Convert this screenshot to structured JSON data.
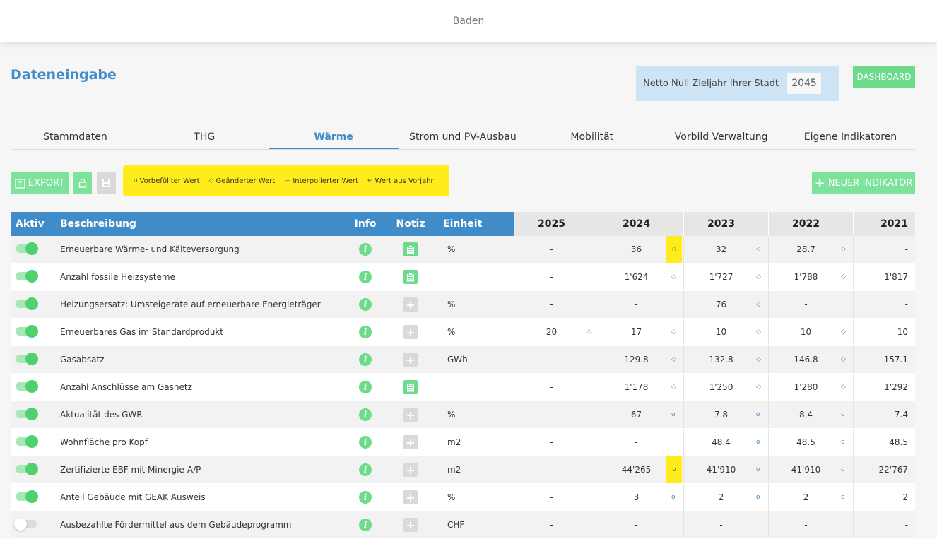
{
  "header": {
    "city": "Baden"
  },
  "page": {
    "title": "Dateneingabe"
  },
  "netto": {
    "label": "Netto Null Zieljahr Ihrer Stadt",
    "year": "2045"
  },
  "dashboard_label": "DASHBOARD",
  "tabs": [
    "Stammdaten",
    "THG",
    "Wärme",
    "Strom und PV-Ausbau",
    "Mobilität",
    "Vorbild Verwaltung",
    "Eigene Indikatoren"
  ],
  "active_tab": "Wärme",
  "toolbar": {
    "export_label": "EXPORT",
    "new_indicator_label": "NEUER INDIKATOR"
  },
  "legend": [
    {
      "symbol": "o",
      "label": "Vorbefüllter Wert"
    },
    {
      "symbol": "◇",
      "label": "Geänderter Wert"
    },
    {
      "symbol": "—",
      "label": "Interpolierter Wert"
    },
    {
      "symbol": "←",
      "label": "Wert aus Vorjahr"
    }
  ],
  "table": {
    "columns": {
      "aktiv": "Aktiv",
      "beschreibung": "Beschreibung",
      "info": "Info",
      "notiz": "Notiz",
      "einheit": "Einheit"
    },
    "years": [
      "2025",
      "2024",
      "2023",
      "2022",
      "2021"
    ],
    "rows": [
      {
        "active": true,
        "desc": "Erneuerbare Wärme- und Kälteversorgung",
        "note": true,
        "unit": "%",
        "values": [
          "-",
          "36",
          "32",
          "28.7",
          "-"
        ],
        "marks": [
          "",
          "◇",
          "◇",
          "◇",
          ""
        ],
        "highlight": [
          false,
          true,
          false,
          false,
          false
        ]
      },
      {
        "active": true,
        "desc": "Anzahl fossile Heizsysteme",
        "note": true,
        "unit": "",
        "values": [
          "-",
          "1'624",
          "1'727",
          "1'788",
          "1'817"
        ],
        "marks": [
          "",
          "◇",
          "◇",
          "◇",
          ""
        ],
        "highlight": [
          false,
          false,
          false,
          false,
          false
        ]
      },
      {
        "active": true,
        "desc": "Heizungsersatz: Umsteigerate auf erneuerbare Energieträger",
        "note": false,
        "unit": "%",
        "values": [
          "-",
          "-",
          "76",
          "-",
          "-"
        ],
        "marks": [
          "",
          "",
          "◇",
          "",
          ""
        ],
        "highlight": [
          false,
          false,
          false,
          false,
          false
        ]
      },
      {
        "active": true,
        "desc": "Erneuerbares Gas im Standardprodukt",
        "note": false,
        "unit": "%",
        "values": [
          "20",
          "17",
          "10",
          "10",
          "10"
        ],
        "marks": [
          "◇",
          "◇",
          "◇",
          "◇",
          ""
        ],
        "highlight": [
          false,
          false,
          false,
          false,
          false
        ]
      },
      {
        "active": true,
        "desc": "Gasabsatz",
        "note": false,
        "unit": "GWh",
        "values": [
          "-",
          "129.8",
          "132.8",
          "146.8",
          "157.1"
        ],
        "marks": [
          "",
          "◇",
          "◇",
          "◇",
          ""
        ],
        "highlight": [
          false,
          false,
          false,
          false,
          false
        ]
      },
      {
        "active": true,
        "desc": "Anzahl Anschlüsse am Gasnetz",
        "note": true,
        "unit": "",
        "values": [
          "-",
          "1'178",
          "1'250",
          "1'280",
          "1'292"
        ],
        "marks": [
          "",
          "◇",
          "◇",
          "◇",
          ""
        ],
        "highlight": [
          false,
          false,
          false,
          false,
          false
        ]
      },
      {
        "active": true,
        "desc": "Aktualität des GWR",
        "note": false,
        "unit": "%",
        "values": [
          "-",
          "67",
          "7.8",
          "8.4",
          "7.4"
        ],
        "marks": [
          "",
          "o",
          "o",
          "o",
          ""
        ],
        "highlight": [
          false,
          false,
          false,
          false,
          false
        ]
      },
      {
        "active": true,
        "desc": "Wohnfläche pro Kopf",
        "note": false,
        "unit": "m2",
        "values": [
          "-",
          "-",
          "48.4",
          "48.5",
          "48.5"
        ],
        "marks": [
          "",
          "",
          "o",
          "o",
          ""
        ],
        "highlight": [
          false,
          false,
          false,
          false,
          false
        ]
      },
      {
        "active": true,
        "desc": "Zertifizierte EBF mit Minergie-A/P",
        "note": false,
        "unit": "m2",
        "values": [
          "-",
          "44'265",
          "41'910",
          "41'910",
          "22'767"
        ],
        "marks": [
          "",
          "o",
          "o",
          "o",
          ""
        ],
        "highlight": [
          false,
          true,
          false,
          false,
          false
        ]
      },
      {
        "active": true,
        "desc": "Anteil Gebäude mit GEAK Ausweis",
        "note": false,
        "unit": "%",
        "values": [
          "-",
          "3",
          "2",
          "2",
          "2"
        ],
        "marks": [
          "",
          "o",
          "o",
          "o",
          ""
        ],
        "highlight": [
          false,
          false,
          false,
          false,
          false
        ]
      },
      {
        "active": false,
        "desc": "Ausbezahlte Fördermittel aus dem Gebäudeprogramm",
        "note": false,
        "unit": "CHF",
        "values": [
          "-",
          "-",
          "-",
          "-",
          "-"
        ],
        "marks": [
          "",
          "",
          "",
          "",
          ""
        ],
        "highlight": [
          false,
          false,
          false,
          false,
          false
        ]
      }
    ]
  },
  "colors": {
    "accent": "#3f8cc9",
    "green": "#6cdc8a",
    "highlight": "#ffec1a",
    "netto_bg": "#cce4f4"
  }
}
